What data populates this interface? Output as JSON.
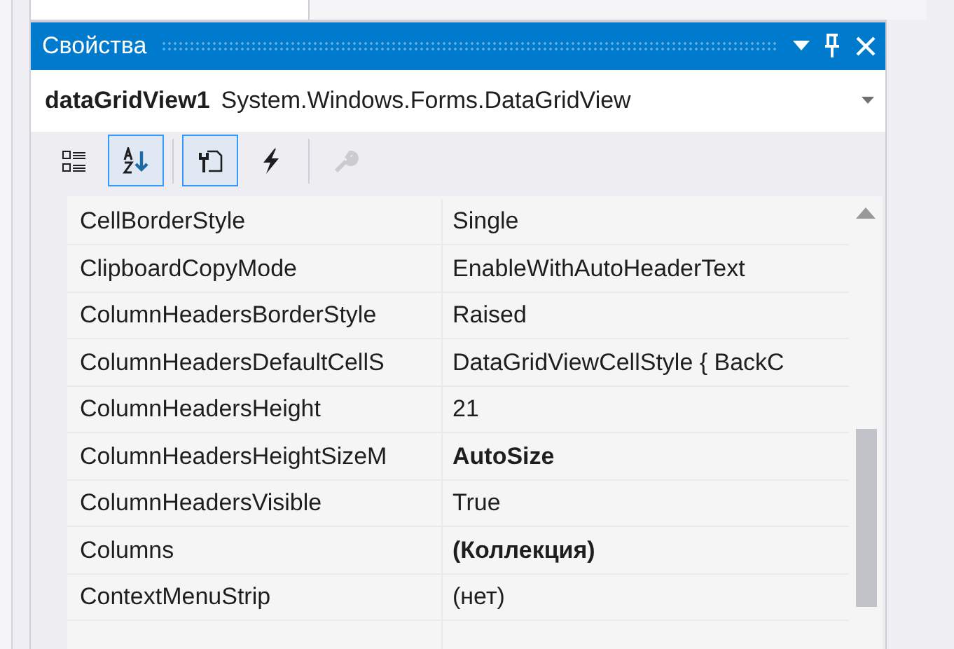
{
  "panel": {
    "title": "Свойства"
  },
  "object": {
    "name": "dataGridView1",
    "type": "System.Windows.Forms.DataGridView"
  },
  "toolbar": [
    {
      "kind": "categorized",
      "selected": false
    },
    {
      "kind": "alphabetical",
      "selected": true
    },
    {
      "kind": "properties",
      "selected": true
    },
    {
      "kind": "events",
      "selected": false
    },
    {
      "kind": "pages",
      "disabled": true
    }
  ],
  "properties": [
    {
      "name": "CellBorderStyle",
      "value": "Single",
      "bold": false
    },
    {
      "name": "ClipboardCopyMode",
      "value": "EnableWithAutoHeaderText",
      "bold": false
    },
    {
      "name": "ColumnHeadersBorderStyle",
      "value": "Raised",
      "bold": false
    },
    {
      "name": "ColumnHeadersDefaultCellS",
      "value": "DataGridViewCellStyle { BackC",
      "bold": false
    },
    {
      "name": "ColumnHeadersHeight",
      "value": "21",
      "bold": false
    },
    {
      "name": "ColumnHeadersHeightSizeM",
      "value": "AutoSize",
      "bold": true
    },
    {
      "name": "ColumnHeadersVisible",
      "value": "True",
      "bold": false
    },
    {
      "name": "Columns",
      "value": "(Коллекция)",
      "bold": true
    },
    {
      "name": "ContextMenuStrip",
      "value": "(нет)",
      "bold": false
    }
  ]
}
